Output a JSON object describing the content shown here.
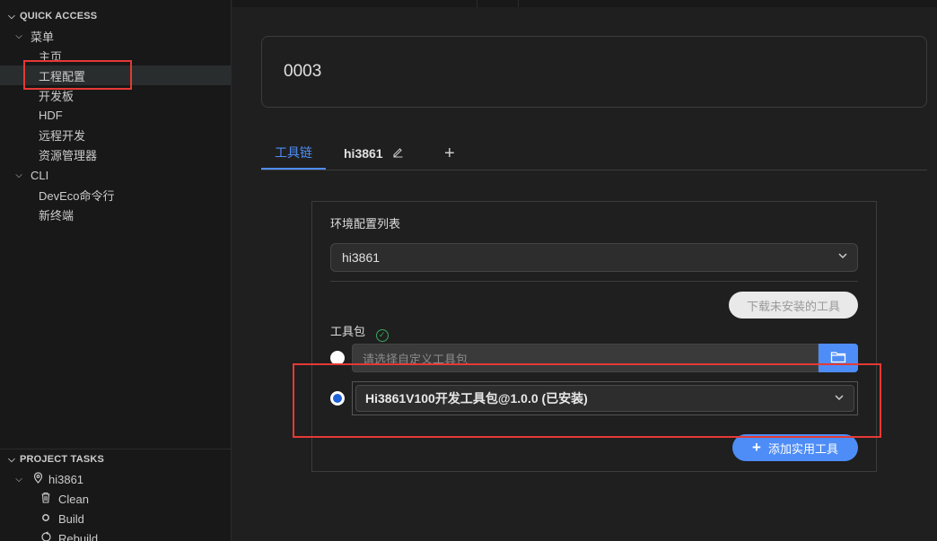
{
  "sidebar": {
    "quick_access": {
      "title": "QUICK ACCESS",
      "menu": {
        "label": "菜单",
        "items": [
          {
            "label": "主页"
          },
          {
            "label": "工程配置"
          },
          {
            "label": "开发板"
          },
          {
            "label": "HDF"
          },
          {
            "label": "远程开发"
          },
          {
            "label": "资源管理器"
          }
        ]
      },
      "cli": {
        "label": "CLI",
        "items": [
          {
            "label": "DevEco命令行"
          },
          {
            "label": "新终端"
          }
        ]
      }
    },
    "project_tasks": {
      "title": "PROJECT TASKS",
      "project": {
        "label": "hi3861",
        "icon": "location-pin-icon"
      },
      "tasks": [
        {
          "label": "Clean",
          "icon": "trash-icon"
        },
        {
          "label": "Build",
          "icon": "circle-icon"
        },
        {
          "label": "Rebuild",
          "icon": "rebuild-icon"
        }
      ]
    }
  },
  "main": {
    "project_name": "0003",
    "tabs": [
      {
        "label": "工具链"
      },
      {
        "label": "hi3861"
      }
    ],
    "add_tab_symbol": "+",
    "panel": {
      "env_config_label": "环境配置列表",
      "env_selected": "hi3861",
      "download_button": "下载未安装的工具",
      "toolkit_label": "工具包",
      "custom_toolkit_placeholder": "请选择自定义工具包",
      "selected_toolkit": "Hi3861V100开发工具包@1.0.0 (已安装)",
      "add_tool_button": "添加实用工具"
    }
  },
  "colors": {
    "accent": "#4e8df7",
    "highlight_red": "#e53935",
    "success_green": "#3ba55d"
  }
}
